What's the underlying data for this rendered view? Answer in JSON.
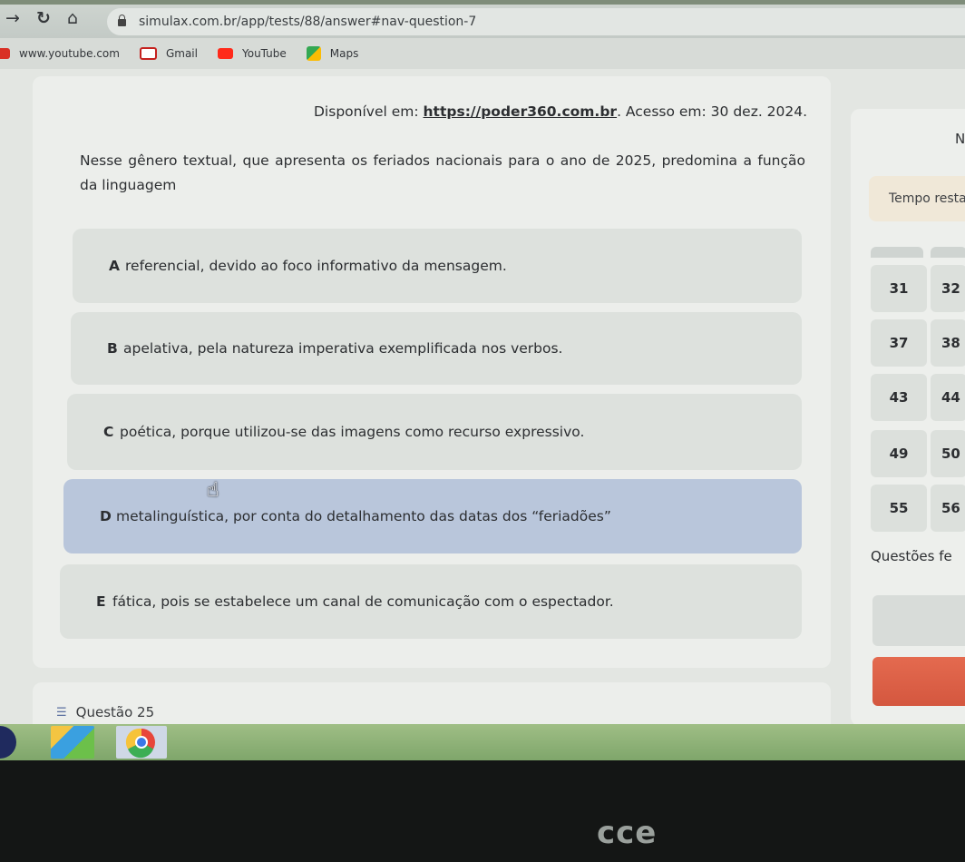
{
  "browser": {
    "url": "simulax.com.br/app/tests/88/answer#nav-question-7",
    "bookmarks": [
      {
        "label": "www.youtube.com",
        "color": "#d93025"
      },
      {
        "label": "Gmail",
        "color": "#c5221f"
      },
      {
        "label": "YouTube",
        "color": "#ff2a1a"
      },
      {
        "label": "Maps",
        "color": "#34a853"
      }
    ]
  },
  "question": {
    "source_prefix": "Disponível em:",
    "source_link": "https://poder360.com.br",
    "source_suffix": ". Acesso em: 30 dez. 2024.",
    "text": "Nesse gênero textual, que apresenta os feriados nacionais para o ano de 2025, predomina a função da linguagem",
    "options": [
      {
        "letter": "A",
        "text": "referencial, devido ao foco informativo da mensagem."
      },
      {
        "letter": "B",
        "text": "apelativa, pela natureza imperativa exemplificada nos verbos."
      },
      {
        "letter": "C",
        "text": "poética, porque utilizou-se das imagens como recurso expressivo."
      },
      {
        "letter": "D",
        "text": "metalinguística, por conta do detalhamento das datas dos “feriadões”"
      },
      {
        "letter": "E",
        "text": "fática, pois se estabelece um canal de comunicação com o espectador."
      }
    ],
    "selected": "D"
  },
  "next_question": {
    "label": "Questão 25"
  },
  "side_panel": {
    "header_fragment": "N",
    "timer_label": "Tempo resta",
    "grid": [
      [
        "31",
        "32"
      ],
      [
        "37",
        "38"
      ],
      [
        "43",
        "44"
      ],
      [
        "49",
        "50"
      ],
      [
        "55",
        "56"
      ]
    ],
    "subtitle": "Questões fe"
  },
  "accent_colors": {
    "selected_option": "#b9c6db",
    "danger": "#e46a4f",
    "taskbar": "#8fb477"
  },
  "device_brand": "cce"
}
